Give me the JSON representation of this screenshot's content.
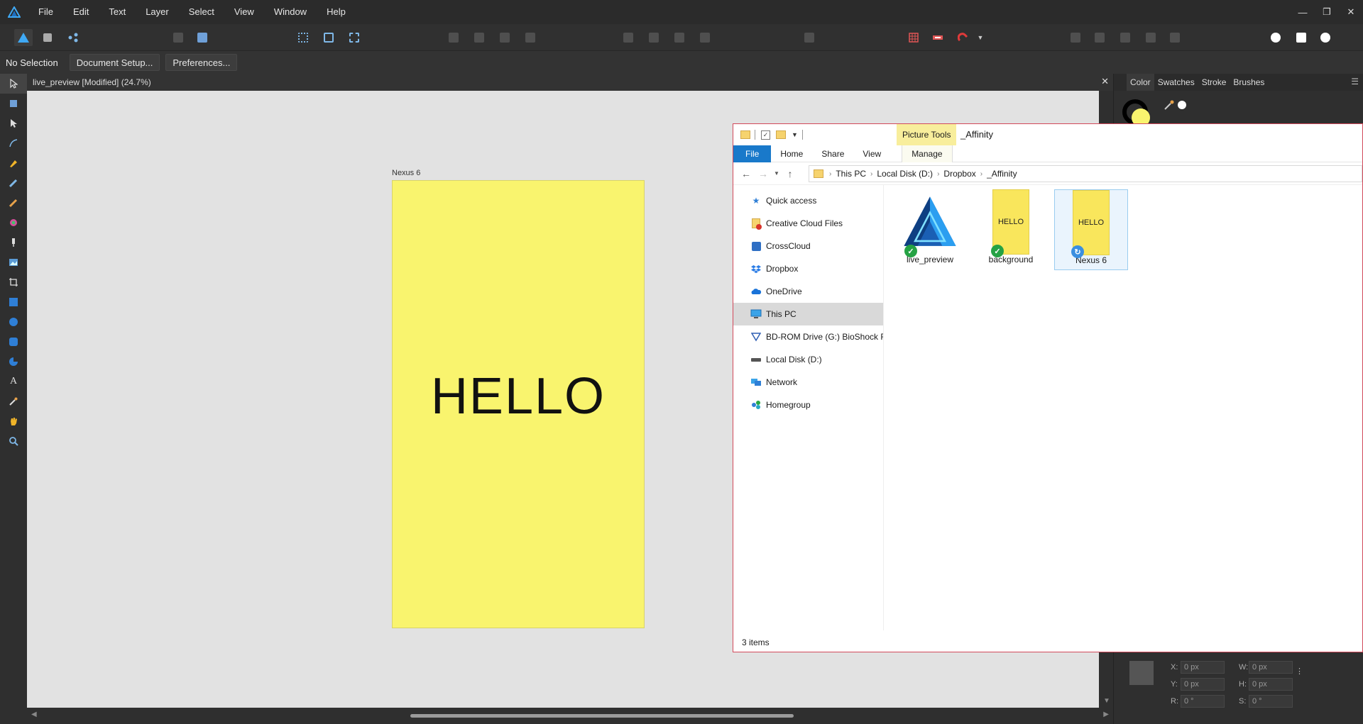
{
  "menu": [
    "File",
    "Edit",
    "Text",
    "Layer",
    "Select",
    "View",
    "Window",
    "Help"
  ],
  "context": {
    "selection": "No Selection",
    "document_setup": "Document Setup...",
    "preferences": "Preferences..."
  },
  "document": {
    "tab_title": "live_preview [Modified] (24.7%)",
    "artboard_name": "Nexus 6",
    "artboard_text": "HELLO",
    "artboard_color": "#f9f46e"
  },
  "right_panel": {
    "tabs": [
      "Color",
      "Swatches",
      "Stroke",
      "Brushes"
    ],
    "transform": {
      "x_label": "X:",
      "x_value": "0 px",
      "y_label": "Y:",
      "y_value": "0 px",
      "w_label": "W:",
      "w_value": "0 px",
      "h_label": "H:",
      "h_value": "0 px",
      "r_label": "R:",
      "r_value": "0 °",
      "s_label": "S:",
      "s_value": "0 °"
    }
  },
  "explorer": {
    "picture_tools": "Picture Tools",
    "folder_name": "_Affinity",
    "ribbon_tabs": [
      "File",
      "Home",
      "Share",
      "View",
      "Manage"
    ],
    "breadcrumb": [
      "This PC",
      "Local Disk (D:)",
      "Dropbox",
      "_Affinity"
    ],
    "nav": [
      {
        "label": "Quick access",
        "icon": "star-icon"
      },
      {
        "label": "Creative Cloud Files",
        "icon": "creative-cloud-icon"
      },
      {
        "label": "CrossCloud",
        "icon": "crosscloud-icon"
      },
      {
        "label": "Dropbox",
        "icon": "dropbox-icon"
      },
      {
        "label": "OneDrive",
        "icon": "onedrive-icon"
      },
      {
        "label": "This PC",
        "icon": "computer-icon"
      },
      {
        "label": "BD-ROM Drive (G:) BioShock Re",
        "icon": "disc-icon"
      },
      {
        "label": "Local Disk (D:)",
        "icon": "drive-icon"
      },
      {
        "label": "Network",
        "icon": "network-icon"
      },
      {
        "label": "Homegroup",
        "icon": "homegroup-icon"
      }
    ],
    "selected_nav": "This PC",
    "files": [
      {
        "name": "live_preview",
        "thumb": "affinity-logo",
        "status": "synced"
      },
      {
        "name": "background",
        "thumb_text": "HELLO",
        "status": "synced"
      },
      {
        "name": "Nexus 6",
        "thumb_text": "HELLO",
        "status": "syncing"
      }
    ],
    "status": "3 items"
  }
}
